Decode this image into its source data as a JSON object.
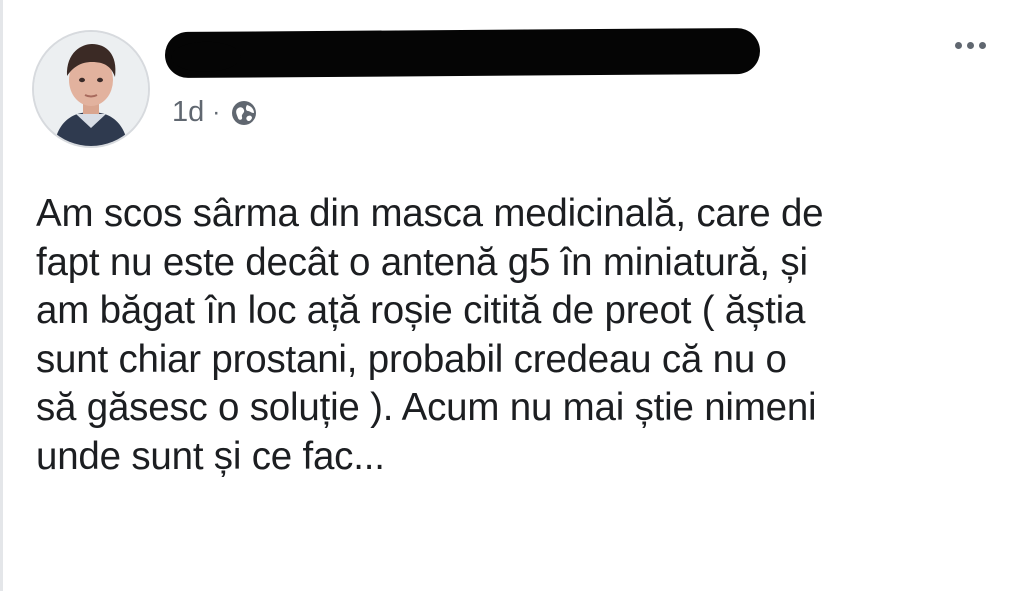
{
  "post": {
    "timestamp": "1d",
    "separator": "·",
    "privacy_icon": "globe-icon",
    "more_icon": "more-options-icon",
    "text_lines": [
      "Am scos sârma din masca medicinală, care de",
      "fapt nu este decât o antenă g5 în miniatură, și",
      "am băgat în loc ață roșie citită de preot ( ăștia",
      "sunt chiar prostani, probabil credeau că nu o",
      "să găsesc o soluție ). Acum nu mai știe nimeni",
      "unde sunt și ce fac..."
    ]
  },
  "colors": {
    "text": "#1c1e21",
    "meta": "#606770",
    "redaction": "#050505",
    "background": "#ffffff"
  }
}
